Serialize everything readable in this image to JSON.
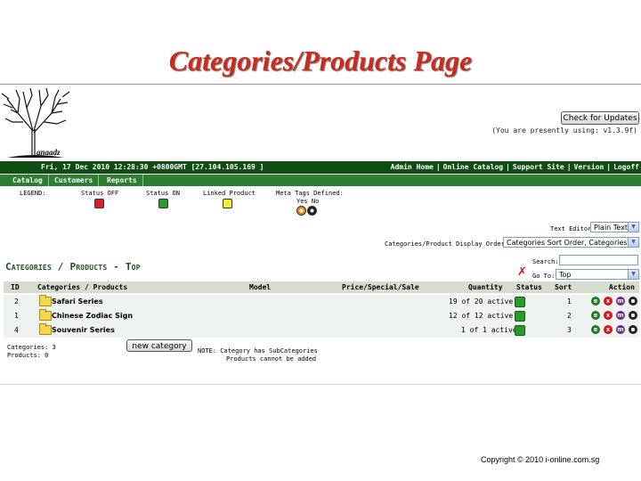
{
  "slide": {
    "title": "Categories/Products Page",
    "copyright": "Copyright © 2010  i-online.com.sg"
  },
  "header": {
    "logo_text": "anaadz",
    "update_button": "Check for Updates",
    "version_text": "(You are presently using: v1.3.9f)",
    "datetime": "Fri, 17 Dec 2010 12:28:30 +0800GMT [27.104.105.169 ]",
    "links": [
      "Admin Home",
      "Online Catalog",
      "Support Site",
      "Version",
      "Logoff"
    ]
  },
  "nav": {
    "items": [
      "Catalog",
      "Customers",
      "Reports"
    ]
  },
  "legend": {
    "label": "LEGEND:",
    "status_off": "Status OFF",
    "status_on": "Status ON",
    "linked": "Linked Product",
    "meta_tags": "Meta Tags Defined:",
    "yes_no": "Yes No",
    "colors": {
      "off": "#d8202a",
      "on": "#2a9a2a",
      "linked": "#f2ec32"
    }
  },
  "controls": {
    "text_editor_label": "Text Editor",
    "text_editor_value": "Plain Text",
    "sort_order_label": "Categories/Product Display Order:",
    "sort_order_value": "Categories Sort Order, Categories Name",
    "search_label": "Search:",
    "search_value": "",
    "goto_label": "Go To:",
    "goto_value": "Top"
  },
  "main": {
    "heading": "Categories / Products - Top",
    "columns": {
      "id": "ID",
      "name": "Categories / Products",
      "model": "Model",
      "price": "Price/Special/Sale",
      "quantity": "Quantity",
      "status": "Status",
      "sort": "Sort",
      "action": "Action"
    },
    "rows": [
      {
        "id": "2",
        "name": "Safari Series",
        "quantity": "19 of 20 active",
        "sort": "1"
      },
      {
        "id": "1",
        "name": "Chinese Zodiac Sign",
        "quantity": "12 of 12 active",
        "sort": "2"
      },
      {
        "id": "4",
        "name": "Souvenir Series",
        "quantity": "1 of 1 active",
        "sort": "3"
      }
    ],
    "action_icons": [
      "e",
      "x",
      "m",
      "meta"
    ],
    "categories_count": "Categories: 3",
    "products_count": "Products: 0",
    "new_category_button": "new category",
    "note_line1": "NOTE: Category has SubCategories",
    "note_line2": "Products cannot be added"
  }
}
